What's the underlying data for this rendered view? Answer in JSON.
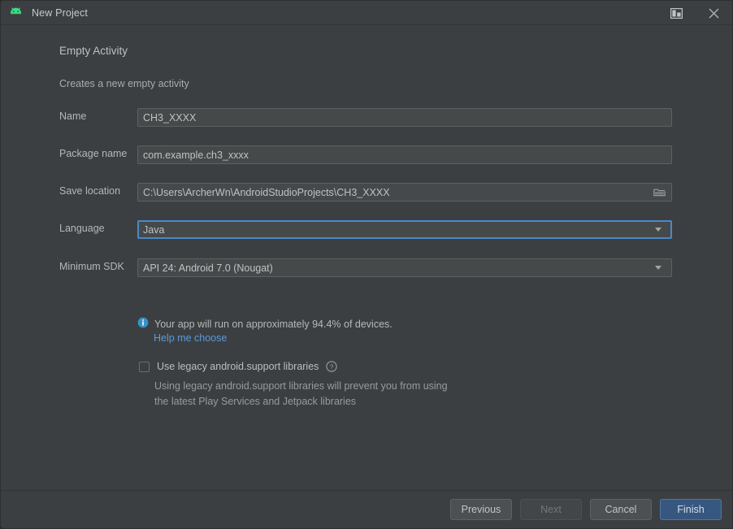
{
  "window": {
    "title": "New Project",
    "app_icon": "android-robot-icon",
    "dock_button": "dock-window-icon",
    "close_button": "close-icon"
  },
  "wizard": {
    "heading": "Empty Activity",
    "subheading": "Creates a new empty activity"
  },
  "fields": {
    "name": {
      "label": "Name",
      "value": "CH3_XXXX"
    },
    "package_name": {
      "label": "Package name",
      "value": "com.example.ch3_xxxx"
    },
    "save_location": {
      "label": "Save location",
      "value": "C:\\Users\\ArcherWn\\AndroidStudioProjects\\CH3_XXXX",
      "browse_icon": "folder-icon"
    },
    "language": {
      "label": "Language",
      "value": "Java",
      "caret_icon": "chevron-down-icon"
    },
    "minimum_sdk": {
      "label": "Minimum SDK",
      "value": "API 24: Android 7.0 (Nougat)",
      "caret_icon": "chevron-down-icon"
    }
  },
  "info": {
    "icon": "info-icon",
    "text": "Your app will run on approximately 94.4% of devices.",
    "link": "Help me choose"
  },
  "legacy": {
    "checkbox_label": "Use legacy android.support libraries",
    "help_icon": "question-mark-icon",
    "description_line1": "Using legacy android.support libraries will prevent you from using",
    "description_line2": "the latest Play Services and Jetpack libraries"
  },
  "footer": {
    "previous": "Previous",
    "next": "Next",
    "cancel": "Cancel",
    "finish": "Finish"
  },
  "colors": {
    "window_bg": "#3c3f41",
    "field_bg": "#45494a",
    "focus_blue": "#4a88c7",
    "primary_button": "#365880",
    "link_blue": "#5b9ad9",
    "android_green": "#3ddc84",
    "info_blue": "#3592c4"
  }
}
